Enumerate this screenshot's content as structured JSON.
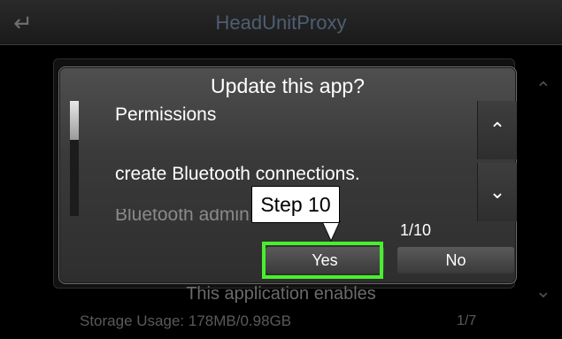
{
  "background": {
    "title": "HeadUnitProxy",
    "description": "This application enables",
    "storage": "Storage Usage: 178MB/0.98GB",
    "page": "1/7"
  },
  "dialog": {
    "title": "Update this app?",
    "permissions_heading": "Permissions",
    "permission_item": "create Bluetooth connections.",
    "next_item_partial": "Bluetooth admin",
    "page_counter": "1/10",
    "yes_label": "Yes",
    "no_label": "No",
    "scroll_position": 0.0
  },
  "annotation": {
    "callout_text": "Step 10",
    "highlight_color": "#47f02d"
  },
  "icons": {
    "back": "back-arrow-icon",
    "up": "chevron-up-icon",
    "down": "chevron-down-icon"
  }
}
